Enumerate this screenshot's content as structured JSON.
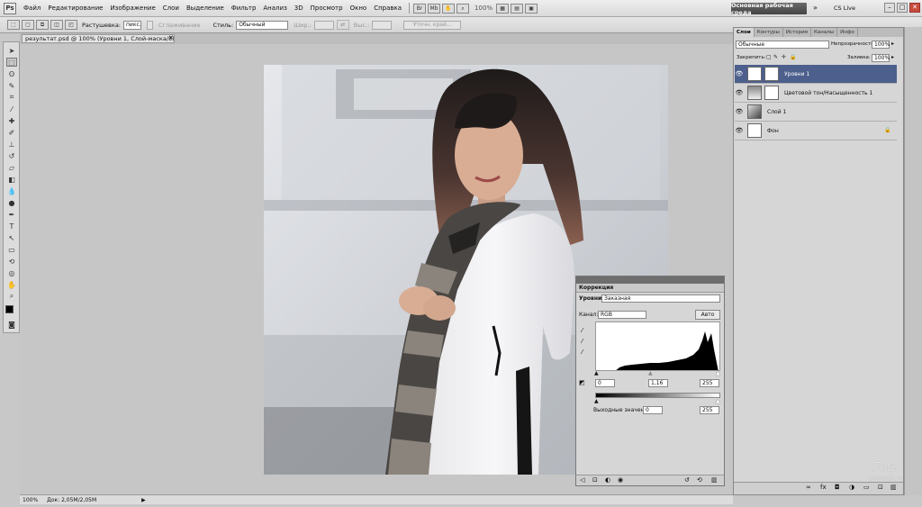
{
  "menubar": {
    "logo": "Ps",
    "items": [
      "Файл",
      "Редактирование",
      "Изображение",
      "Слои",
      "Выделение",
      "Фильтр",
      "Анализ",
      "3D",
      "Просмотр",
      "Окно",
      "Справка"
    ],
    "zoom": "100%",
    "workspace": "Основная рабочая среда",
    "cslive": "CS Live"
  },
  "options": {
    "feather_label": "Растушевка:",
    "feather_value": "пикс.",
    "antialias_label": "Сглаживание",
    "style_label": "Стиль:",
    "style_value": "Обычный",
    "width_label": "Шир.:",
    "height_label": "Выс.:",
    "refine_label": "Уточн. край..."
  },
  "document": {
    "tab_title": "результат.psd @ 100% (Уровни 1, Слой-маска/8) *"
  },
  "status": {
    "zoom": "100%",
    "doc_info": "Док: 2,05M/2,05M"
  },
  "layers_panel": {
    "tabs": [
      "Слои",
      "Контуры",
      "История",
      "Каналы",
      "Инфо"
    ],
    "blend_mode": "Обычные",
    "opacity_label": "Непрозрачность:",
    "opacity_value": "100%",
    "lock_label": "Закрепить:",
    "fill_label": "Заливка:",
    "fill_value": "100%",
    "layers": [
      {
        "name": "Уровни 1"
      },
      {
        "name": "Цветовой тон/Насыщенность 1"
      },
      {
        "name": "Слой 1"
      },
      {
        "name": "Фон"
      }
    ]
  },
  "adjustments": {
    "title": "Коррекция",
    "preset_label": "Уровни",
    "preset_value": "Заказная",
    "channel_label": "Канал:",
    "channel_value": "RGB",
    "auto_label": "Авто",
    "input_black": "0",
    "input_gamma": "1,16",
    "input_white": "255",
    "output_label": "Выходные значения:",
    "output_black": "0",
    "output_white": "255"
  },
  "watermark": {
    "line1": "Foto",
    "line2": "Komok.ru"
  }
}
